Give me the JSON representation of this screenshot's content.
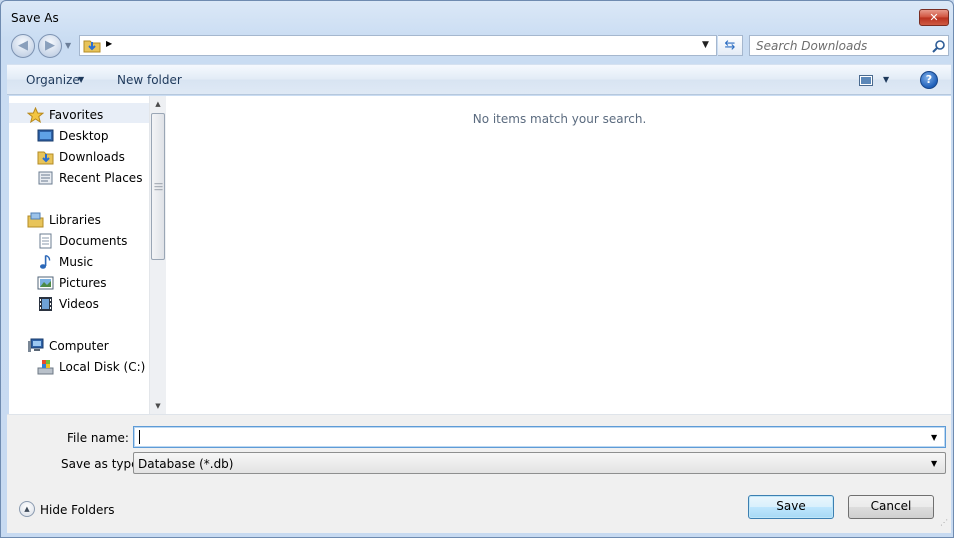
{
  "window": {
    "title": "Save As",
    "close_glyph": "✕"
  },
  "nav": {
    "back_icon": "back-arrow-icon",
    "forward_icon": "forward-arrow-icon",
    "address_icon": "downloads-folder-icon",
    "refresh_icon": "refresh-icon",
    "search_placeholder": "Search Downloads"
  },
  "commandbar": {
    "organize_label": "Organize",
    "new_folder_label": "New folder",
    "views_icon": "views-icon",
    "help_glyph": "?"
  },
  "navpane": {
    "items": [
      {
        "label": "Favorites",
        "icon": "star-icon"
      },
      {
        "label": "Desktop",
        "icon": "desktop-icon"
      },
      {
        "label": "Downloads",
        "icon": "downloads-folder-icon"
      },
      {
        "label": "Recent Places",
        "icon": "recent-places-icon"
      },
      {
        "label": "Libraries",
        "icon": "libraries-icon"
      },
      {
        "label": "Documents",
        "icon": "documents-icon"
      },
      {
        "label": "Music",
        "icon": "music-icon"
      },
      {
        "label": "Pictures",
        "icon": "pictures-icon"
      },
      {
        "label": "Videos",
        "icon": "videos-icon"
      },
      {
        "label": "Computer",
        "icon": "computer-icon"
      },
      {
        "label": "Local Disk (C:)",
        "icon": "local-disk-icon"
      }
    ]
  },
  "content": {
    "empty_message": "No items match your search."
  },
  "bottom": {
    "filename_label": "File name:",
    "filename_value": "",
    "savetype_label": "Save as type:",
    "savetype_value": "Database (*.db)",
    "hide_folders_label": "Hide Folders",
    "save_label": "Save",
    "cancel_label": "Cancel"
  },
  "colors": {
    "accent": "#3c7fb1",
    "frame": "#c7daf1",
    "content_bg": "#ffffff"
  }
}
